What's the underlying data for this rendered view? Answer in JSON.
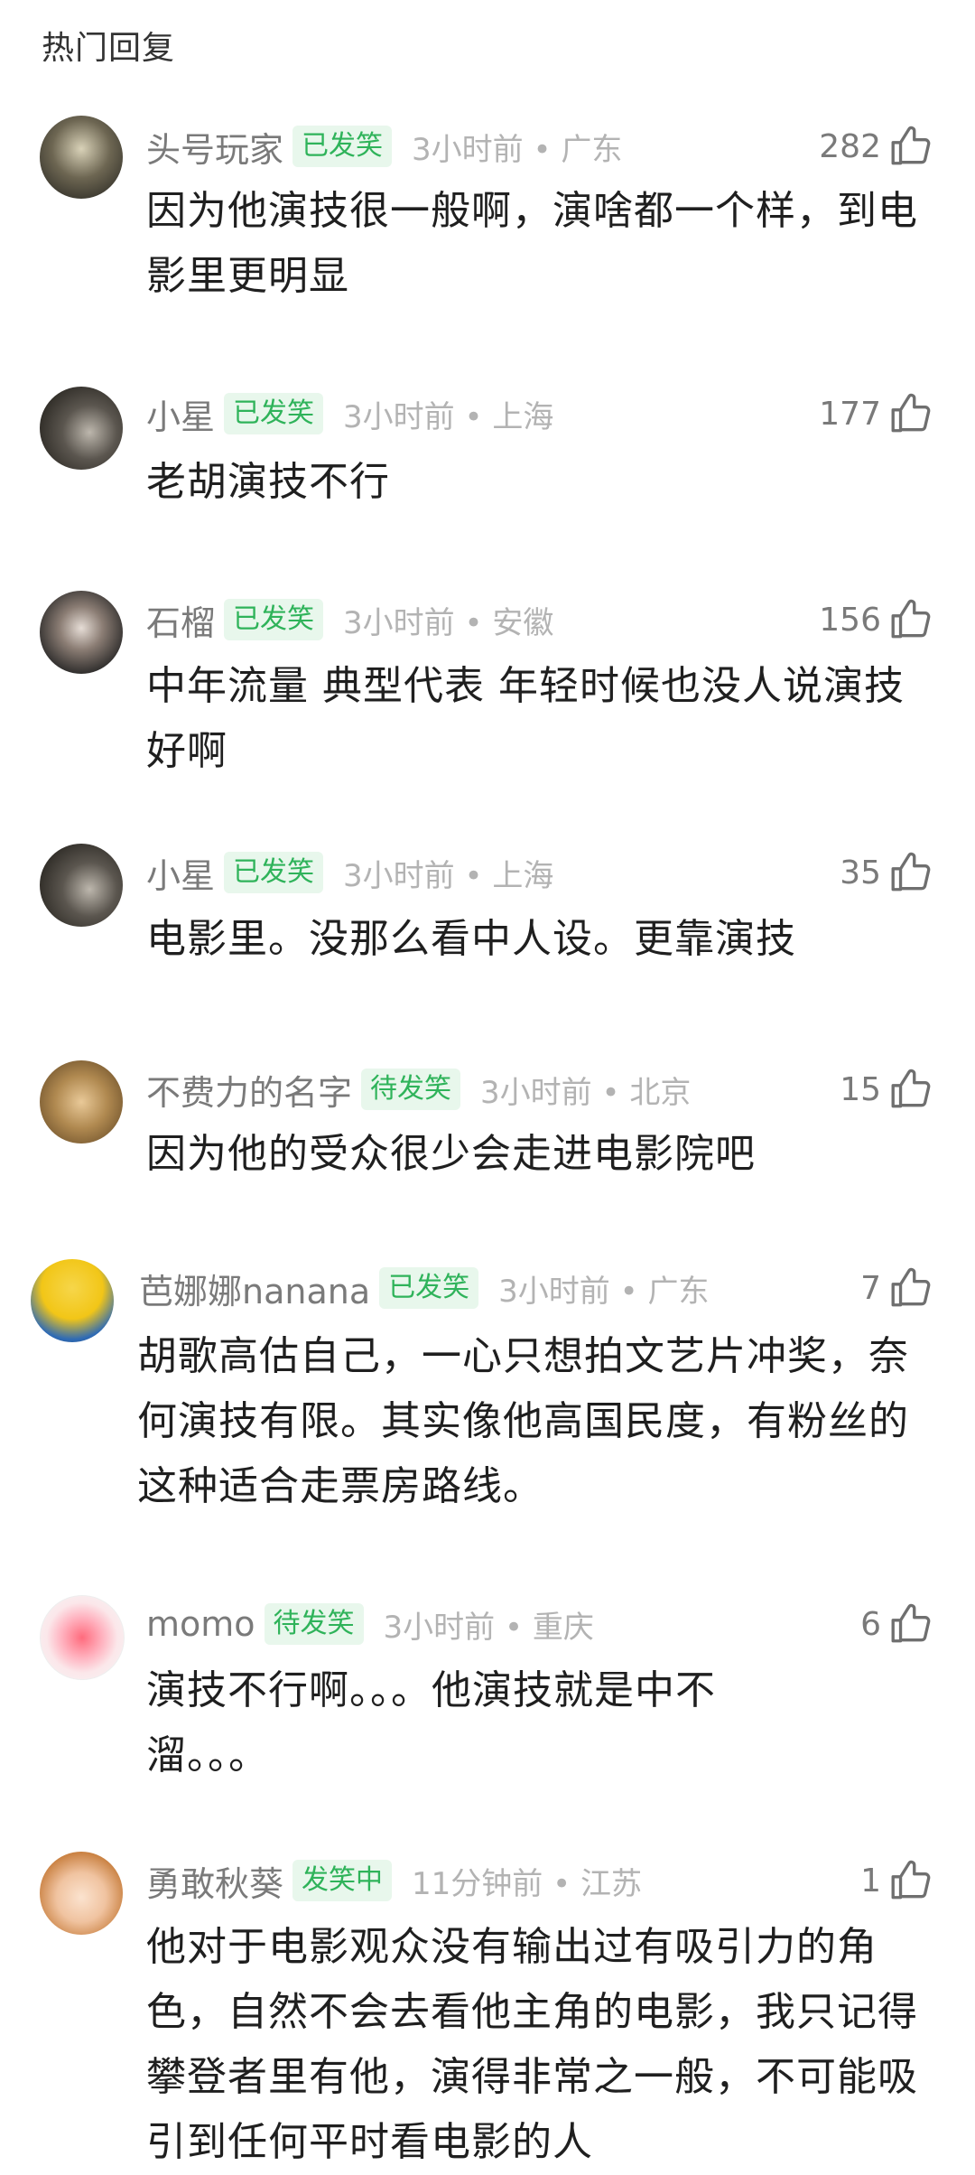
{
  "section_title": "热门回复",
  "comments": [
    {
      "username": "头号玩家",
      "badge": "已发笑",
      "time": "3小时前",
      "location": "广东",
      "likes": "282",
      "text": "因为他演技很一般啊，演啥都一个样，到电影里更明显"
    },
    {
      "username": "小星",
      "badge": "已发笑",
      "time": "3小时前",
      "location": "上海",
      "likes": "177",
      "text": "老胡演技不行"
    },
    {
      "username": "石榴",
      "badge": "已发笑",
      "time": "3小时前",
      "location": "安徽",
      "likes": "156",
      "text": "中年流量 典型代表 年轻时候也没人说演技好啊"
    },
    {
      "username": "小星",
      "badge": "已发笑",
      "time": "3小时前",
      "location": "上海",
      "likes": "35",
      "text": "电影里。没那么看中人设。更靠演技"
    },
    {
      "username": "不费力的名字",
      "badge": "待发笑",
      "time": "3小时前",
      "location": "北京",
      "likes": "15",
      "text": "因为他的受众很少会走进电影院吧"
    },
    {
      "username": "芭娜娜nanana",
      "badge": "已发笑",
      "time": "3小时前",
      "location": "广东",
      "likes": "7",
      "text": "胡歌高估自己，一心只想拍文艺片冲奖，奈何演技有限。其实像他高国民度，有粉丝的这种适合走票房路线。"
    },
    {
      "username": "momo",
      "badge": "待发笑",
      "time": "3小时前",
      "location": "重庆",
      "likes": "6",
      "text": "演技不行啊。。。他演技就是中不溜。。。"
    },
    {
      "username": "勇敢秋葵",
      "badge": "发笑中",
      "time": "11分钟前",
      "location": "江苏",
      "likes": "1",
      "text": "他对于电影观众没有输出过有吸引力的角色，自然不会去看他主角的电影，我只记得攀登者里有他，演得非常之一般，不可能吸引到任何平时看电影的人"
    }
  ],
  "separator": "•",
  "colors": {
    "badge_text": "#2fb35a",
    "badge_bg": "#e8f7ec",
    "meta": "#b3b3b3",
    "username": "#7a7a7a"
  },
  "icons": {
    "like": "thumbs-up-icon"
  }
}
